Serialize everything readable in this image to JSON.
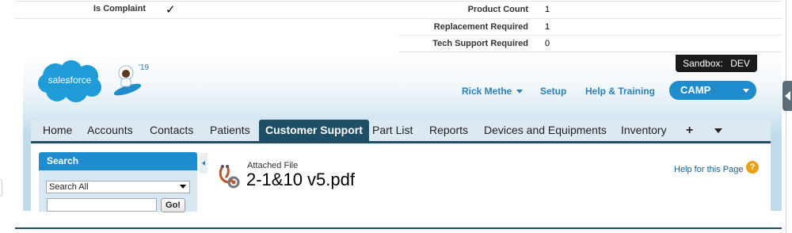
{
  "detail": {
    "left_label": "Is Complaint",
    "left_value": "✓",
    "rows": [
      {
        "label": "Product Count",
        "value": "1"
      },
      {
        "label": "Replacement Required",
        "value": "1"
      },
      {
        "label": "Tech Support Required",
        "value": "0"
      }
    ]
  },
  "header": {
    "logo_text": "salesforce",
    "release_badge": "'19",
    "sandbox_label": "Sandbox:",
    "sandbox_value": "DEV",
    "user_menu": "Rick Methe",
    "setup": "Setup",
    "help_training": "Help & Training",
    "app_switcher": "CAMP"
  },
  "tabs": [
    {
      "label": "Home",
      "active": false
    },
    {
      "label": "Accounts",
      "active": false
    },
    {
      "label": "Contacts",
      "active": false
    },
    {
      "label": "Patients",
      "active": false
    },
    {
      "label": "Customer Support",
      "active": true
    },
    {
      "label": "Part List",
      "active": false
    },
    {
      "label": "Reports",
      "active": false
    },
    {
      "label": "Devices and Equipments",
      "active": false
    },
    {
      "label": "Inventory",
      "active": false
    },
    {
      "label": "+",
      "active": false
    }
  ],
  "sidebar": {
    "title": "Search",
    "scope_selected": "Search All",
    "search_value": "",
    "go_button": "Go!"
  },
  "page": {
    "object_type": "Attached File",
    "record_name": "2-1&10 v5.pdf",
    "help_link": "Help for this Page",
    "help_icon": "?"
  },
  "colors": {
    "brand_blue": "#1f8dcd",
    "tab_active": "#1f4f66",
    "link": "#2a80b9",
    "help_icon": "#e8a21a"
  }
}
